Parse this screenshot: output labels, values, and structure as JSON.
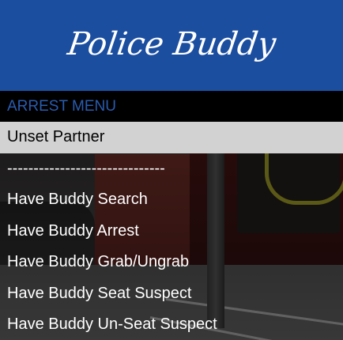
{
  "header": {
    "title": "Police Buddy"
  },
  "subtitle": "ARREST MENU",
  "menu": {
    "items": [
      {
        "label": "Unset Partner",
        "selected": true
      },
      {
        "label": "------------------------------",
        "selected": false
      },
      {
        "label": "Have Buddy Search",
        "selected": false
      },
      {
        "label": "Have Buddy Arrest",
        "selected": false
      },
      {
        "label": "Have Buddy Grab/Ungrab",
        "selected": false
      },
      {
        "label": "Have Buddy Seat Suspect",
        "selected": false
      },
      {
        "label": "Have Buddy Un-Seat Suspect",
        "selected": false
      }
    ]
  },
  "colors": {
    "header_bg": "#1c4ea0",
    "subtitle_text": "#2a5cb0",
    "selected_bg": "#d2d2d2",
    "item_text": "#ffffff"
  }
}
